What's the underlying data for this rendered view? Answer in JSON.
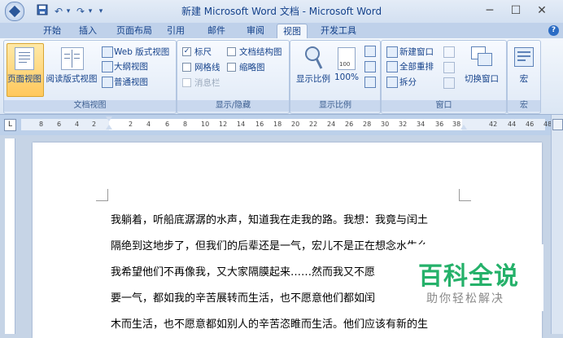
{
  "window": {
    "title": "新建 Microsoft Word 文档 - Microsoft Word",
    "minimize": "─",
    "maximize": "☐",
    "close": "✕"
  },
  "quick_access": {
    "save_icon": "save-icon",
    "undo": "↶",
    "redo": "↷",
    "dropdown": "▾"
  },
  "tabs": [
    "开始",
    "插入",
    "页面布局",
    "引用",
    "邮件",
    "审阅",
    "视图",
    "开发工具"
  ],
  "active_tab": "视图",
  "help": "?",
  "ribbon": {
    "doc_views": {
      "title": "文档视图",
      "page_view": "页面视图",
      "reading_view": "阅读版式视图",
      "web_view": "Web 版式视图",
      "outline_view": "大纲视图",
      "draft_view": "普通视图"
    },
    "show_hide": {
      "title": "显示/隐藏",
      "ruler": "标尺",
      "gridlines": "网格线",
      "message_bar": "消息栏",
      "doc_map": "文档结构图",
      "thumbnails": "缩略图",
      "ruler_checked": "✓"
    },
    "zoom": {
      "title": "显示比例",
      "zoom_button": "显示比例",
      "zoom_100": "100%"
    },
    "window_group": {
      "title": "窗口",
      "new_window": "新建窗口",
      "arrange_all": "全部重排",
      "split": "拆分",
      "switch_windows": "切换窗口"
    },
    "macros": {
      "title": "宏",
      "button": "宏"
    }
  },
  "ruler_ticks": [
    "8",
    "6",
    "4",
    "2",
    "2",
    "4",
    "6",
    "8",
    "10",
    "12",
    "14",
    "16",
    "18",
    "20",
    "22",
    "24",
    "26",
    "28",
    "30",
    "32",
    "34",
    "36",
    "38",
    "42",
    "44",
    "46",
    "48"
  ],
  "document": {
    "lines": [
      "我躺着，听船底潺潺的水声，知道我在走我的路。我想：我竟与闰土",
      "隔绝到这地步了，但我们的后辈还是一气，宏儿不是正在想念水生么",
      "我希望他们不再像我，又大家隔膜起来……然而我又不愿",
      "要一气，都如我的辛苦展转而生活，也不愿意他们都如闰",
      "木而生活，也不愿意都如别人的辛苦恣睢而生活。他们应该有新的生"
    ]
  },
  "watermark": {
    "title": "百科全说",
    "subtitle": "助你轻松解决"
  }
}
